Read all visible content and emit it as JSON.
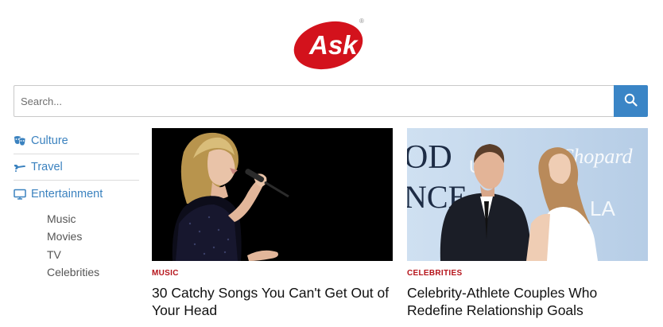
{
  "logo": {
    "text": "Ask",
    "registered": "®",
    "brand_color": "#d3121c"
  },
  "search": {
    "placeholder": "Search...",
    "value": "",
    "button_color": "#3a85c6"
  },
  "sidebar": {
    "items": [
      {
        "label": "Culture",
        "icon": "masks-icon"
      },
      {
        "label": "Travel",
        "icon": "plane-icon"
      },
      {
        "label": "Entertainment",
        "icon": "monitor-icon"
      }
    ],
    "sub_items": [
      "Music",
      "Movies",
      "TV",
      "Celebrities"
    ],
    "link_color": "#3b82bf"
  },
  "cards": [
    {
      "category": "MUSIC",
      "title": "30 Catchy Songs You Can't Get Out of Your Head"
    },
    {
      "category": "CELEBRITIES",
      "title": "Celebrity-Athlete Couples Who Redefine Relationship Goals",
      "image_text": {
        "left": "OD",
        "left2": "NCE",
        "brand": "Chopard",
        "mid": "U A",
        "right": "LA"
      }
    }
  ],
  "colors": {
    "category": "#b5141b"
  }
}
